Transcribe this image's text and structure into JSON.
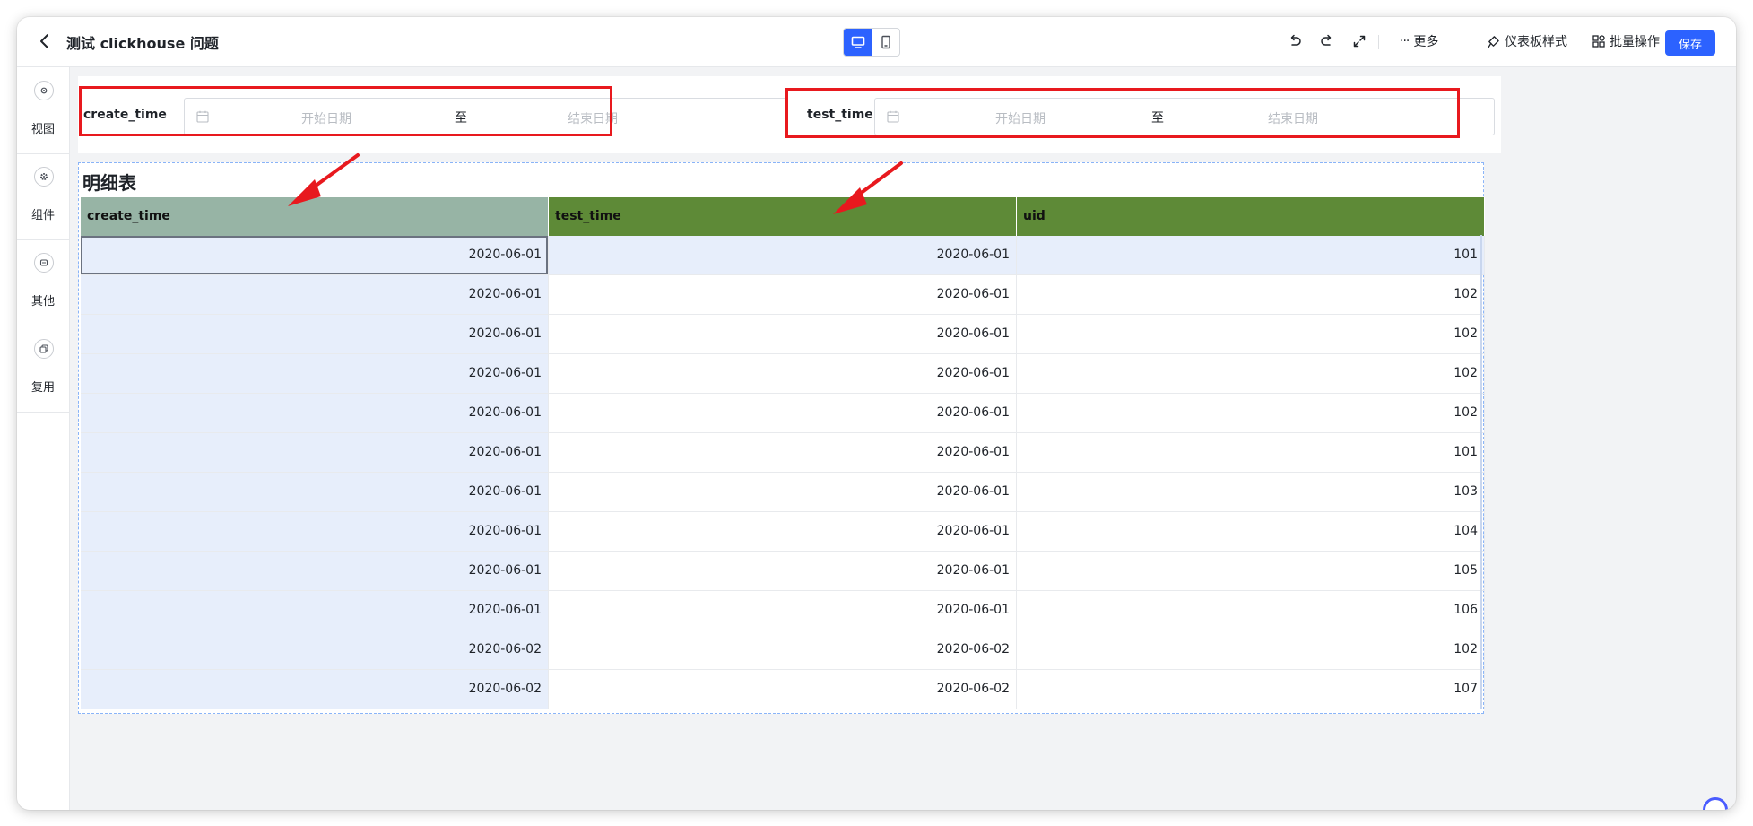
{
  "header": {
    "title": "测试 clickhouse 问题",
    "more_label": "更多",
    "style_label": "仪表板样式",
    "batch_label": "批量操作",
    "save_label": "保存"
  },
  "sidebar": {
    "items": [
      {
        "label": "视图",
        "icon": "view-icon"
      },
      {
        "label": "组件",
        "icon": "gear-icon"
      },
      {
        "label": "其他",
        "icon": "other-icon"
      },
      {
        "label": "复用",
        "icon": "copy-icon"
      }
    ]
  },
  "filters": [
    {
      "label": "create_time",
      "start_placeholder": "开始日期",
      "separator": "至",
      "end_placeholder": "结束日期"
    },
    {
      "label": "test_time",
      "start_placeholder": "开始日期",
      "separator": "至",
      "end_placeholder": "结束日期"
    }
  ],
  "table_widget": {
    "title": "明细表",
    "columns": [
      "create_time",
      "test_time",
      "uid"
    ],
    "rows": [
      [
        "2020-06-01",
        "2020-06-01",
        "101"
      ],
      [
        "2020-06-01",
        "2020-06-01",
        "102"
      ],
      [
        "2020-06-01",
        "2020-06-01",
        "102"
      ],
      [
        "2020-06-01",
        "2020-06-01",
        "102"
      ],
      [
        "2020-06-01",
        "2020-06-01",
        "102"
      ],
      [
        "2020-06-01",
        "2020-06-01",
        "101"
      ],
      [
        "2020-06-01",
        "2020-06-01",
        "103"
      ],
      [
        "2020-06-01",
        "2020-06-01",
        "104"
      ],
      [
        "2020-06-01",
        "2020-06-01",
        "105"
      ],
      [
        "2020-06-01",
        "2020-06-01",
        "106"
      ],
      [
        "2020-06-02",
        "2020-06-02",
        "102"
      ],
      [
        "2020-06-02",
        "2020-06-02",
        "107"
      ]
    ],
    "header_colors": [
      "#97b4a5",
      "#5e8a37",
      "#5e8a37"
    ]
  },
  "colors": {
    "accent": "#2c62ff",
    "annotation": "#e8191e",
    "selected_cell": "#e7eefb"
  }
}
